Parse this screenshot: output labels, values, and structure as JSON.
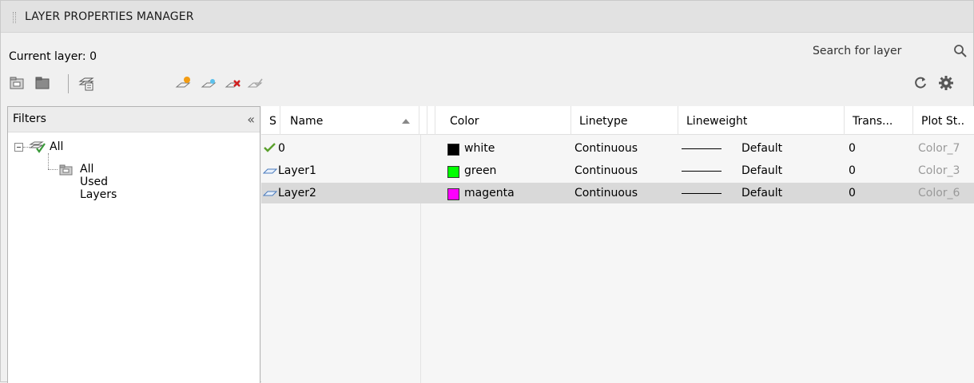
{
  "app": {
    "title": "LAYER PROPERTIES MANAGER"
  },
  "status": {
    "current_layer": "Current layer: 0"
  },
  "search": {
    "placeholder": "Search for layer",
    "icon": "search-icon"
  },
  "toolbar": {
    "left_icons": [
      "new-property-filter-icon",
      "new-group-filter-icon",
      "layer-states-manager-icon"
    ],
    "layer_icons": [
      "new-layer-icon",
      "new-layer-vp-frozen-icon",
      "delete-layer-icon",
      "set-current-icon"
    ],
    "right_icons": [
      "refresh-icon",
      "settings-icon"
    ]
  },
  "filters": {
    "title": "Filters",
    "collapse": "«",
    "tree": {
      "root": "All",
      "child": "All Used Layers"
    }
  },
  "grid": {
    "columns": {
      "status": "S",
      "name": "Name",
      "color": "Color",
      "linetype": "Linetype",
      "lineweight": "Lineweight",
      "transparency": "Trans...",
      "plot_style": "Plot St.."
    },
    "rows": [
      {
        "status_icon": "current-layer-check-icon",
        "name": "0",
        "color_name": "white",
        "color_hex": "#000000",
        "linetype": "Continuous",
        "lineweight": "Default",
        "transparency": "0",
        "plot_style": "Color_7",
        "selected": false
      },
      {
        "status_icon": "layer-icon",
        "name": "Layer1",
        "color_name": "green",
        "color_hex": "#00ff00",
        "linetype": "Continuous",
        "lineweight": "Default",
        "transparency": "0",
        "plot_style": "Color_3",
        "selected": false
      },
      {
        "status_icon": "layer-icon",
        "name": "Layer2",
        "color_name": "magenta",
        "color_hex": "#ff00ff",
        "linetype": "Continuous",
        "lineweight": "Default",
        "transparency": "0",
        "plot_style": "Color_6",
        "selected": true
      }
    ]
  }
}
